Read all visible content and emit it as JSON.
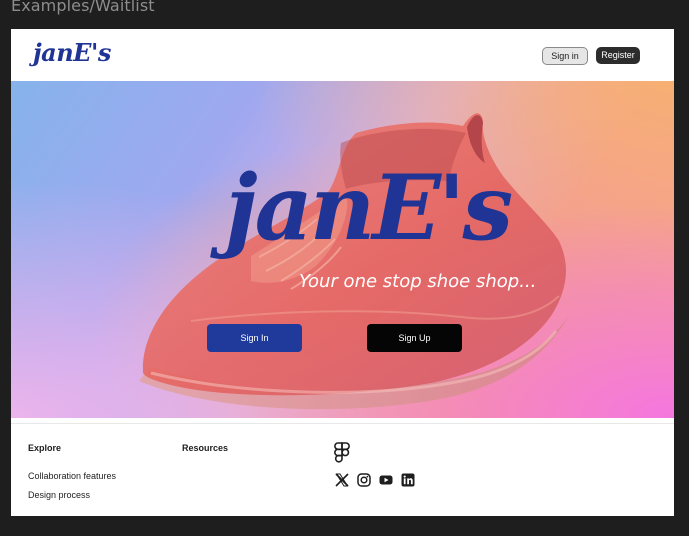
{
  "frame_title": "Examples/Waitlist",
  "nav": {
    "logo": "janE's",
    "signin_label": "Sign in",
    "register_label": "Register"
  },
  "hero": {
    "logo": "janE's",
    "tagline": "Your one stop shoe shop...",
    "signin_label": "Sign In",
    "signup_label": "Sign Up"
  },
  "footer": {
    "explore_heading": "Explore",
    "explore_links": [
      "Collaboration features",
      "Design process"
    ],
    "resources_heading": "Resources",
    "icons": [
      "figma-icon",
      "x-icon",
      "instagram-icon",
      "youtube-icon",
      "linkedin-icon"
    ]
  },
  "colors": {
    "brand": "#1f3494",
    "canvas": "#1e1e1e",
    "shoe": "#e86b66"
  }
}
